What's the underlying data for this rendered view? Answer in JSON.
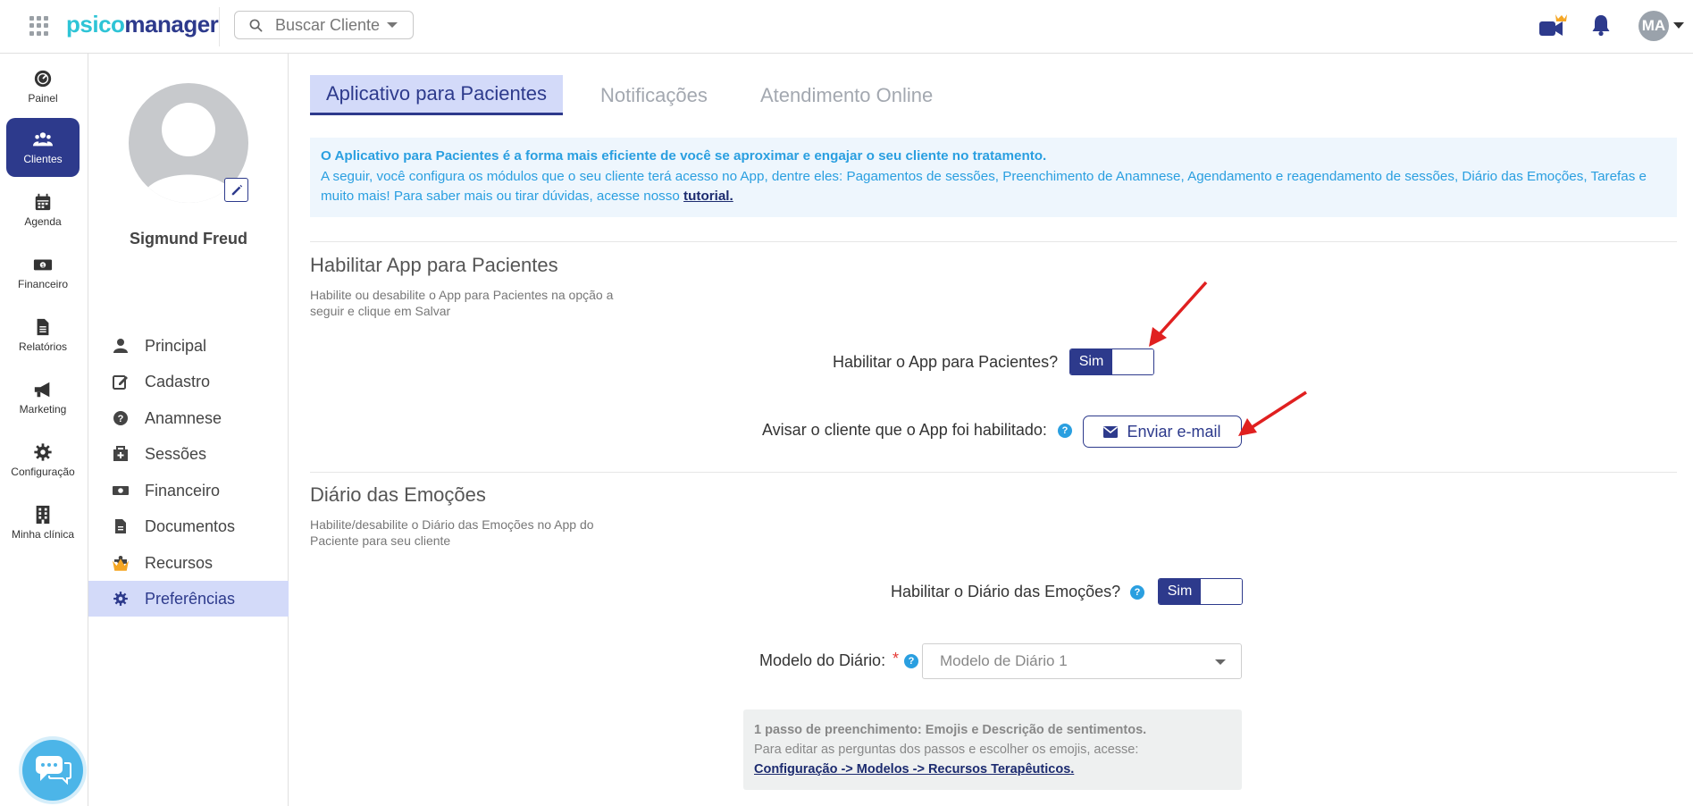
{
  "app": {
    "logo_part1": "psico",
    "logo_part2": "manager",
    "search_placeholder": "Buscar Cliente",
    "avatar_initials": "MA"
  },
  "leftnav": {
    "items": [
      {
        "label": "Painel",
        "icon": "dashboard-icon"
      },
      {
        "label": "Clientes",
        "icon": "users-icon"
      },
      {
        "label": "Agenda",
        "icon": "calendar-icon"
      },
      {
        "label": "Financeiro",
        "icon": "money-icon"
      },
      {
        "label": "Relatórios",
        "icon": "file-icon"
      },
      {
        "label": "Marketing",
        "icon": "megaphone-icon"
      },
      {
        "label": "Configuração",
        "icon": "gear-icon"
      },
      {
        "label": "Minha clínica",
        "icon": "building-icon"
      }
    ],
    "active": "Clientes"
  },
  "profile": {
    "name": "Sigmund Freud",
    "menu": [
      {
        "label": "Principal",
        "icon": "user-icon"
      },
      {
        "label": "Cadastro",
        "icon": "edit-icon"
      },
      {
        "label": "Anamnese",
        "icon": "question-icon"
      },
      {
        "label": "Sessões",
        "icon": "clinic-icon"
      },
      {
        "label": "Financeiro",
        "icon": "money-icon"
      },
      {
        "label": "Documentos",
        "icon": "document-icon"
      },
      {
        "label": "Recursos",
        "icon": "puzzle-icon"
      },
      {
        "label": "Preferências",
        "icon": "gear-icon"
      }
    ],
    "active": "Preferências"
  },
  "tabs": [
    "Aplicativo para Pacientes",
    "Notificações",
    "Atendimento Online"
  ],
  "info": {
    "line1": "O Aplicativo para Pacientes é a forma mais eficiente de você se aproximar e engajar o seu cliente no tratamento.",
    "line2": "A seguir, você configura os módulos que o seu cliente terá acesso no App, dentre eles: Pagamentos de sessões, Preenchimento de Anamnese, Agendamento e reagendamento de sessões, Diário das Emoções, Tarefas e muito mais! Para saber mais ou tirar dúvidas, acesse nosso",
    "link": "tutorial."
  },
  "section_app": {
    "title": "Habilitar App para Pacientes",
    "desc": "Habilite ou desabilite o App para Pacientes na opção a seguir e clique em Salvar",
    "enable_label": "Habilitar o App para Pacientes?",
    "toggle": "Sim",
    "notify_label": "Avisar o cliente que o App foi habilitado:",
    "email_button": "Enviar e-mail"
  },
  "section_diary": {
    "title": "Diário das Emoções",
    "desc": "Habilite/desabilite o Diário das Emoções no App do Paciente para seu cliente",
    "enable_label": "Habilitar o Diário das Emoções?",
    "toggle": "Sim",
    "model_label": "Modelo do Diário:",
    "required_mark": "*",
    "model_value": "Modelo de Diário 1",
    "note_bold": "1 passo de preenchimento: Emojis e Descrição de sentimentos.",
    "note_text": "Para editar as perguntas dos passos e escolher os emojis, acesse:",
    "note_link": "Configuração -> Modelos -> Recursos Terapêuticos."
  },
  "colors": {
    "brand": "#2d3a8c",
    "accent": "#2ec4d6",
    "info_text": "#2a9fe0",
    "annotation_arrow": "#e02020"
  }
}
